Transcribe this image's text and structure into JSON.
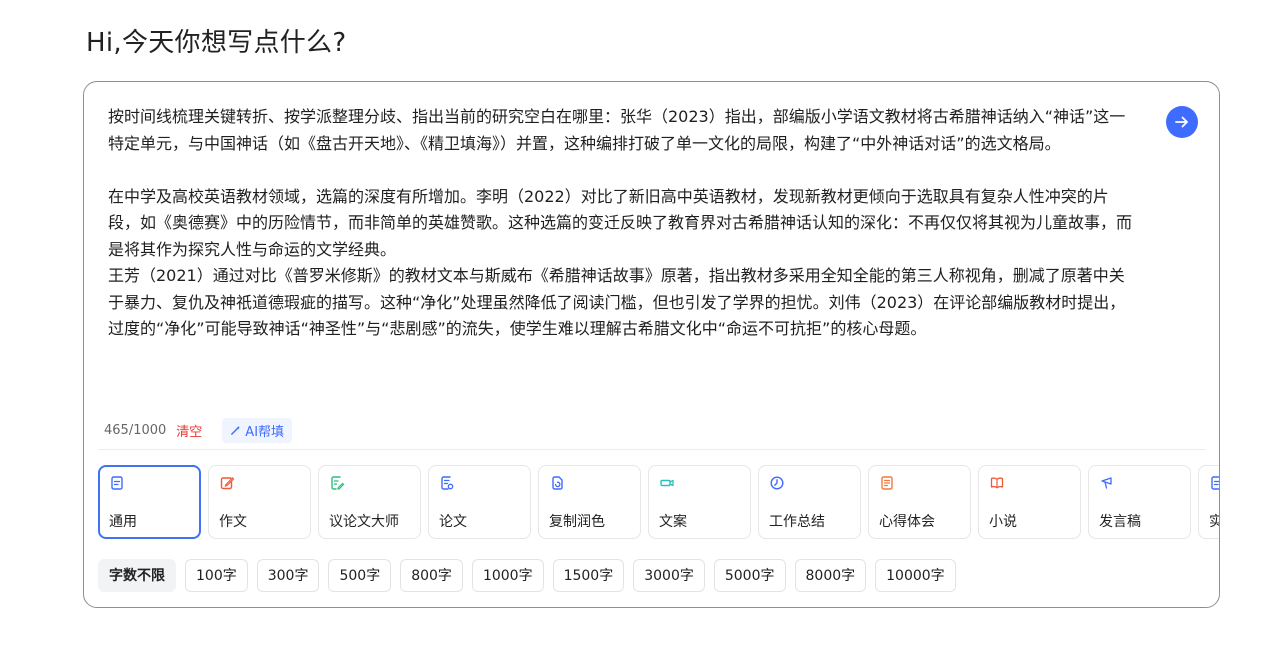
{
  "greeting": "Hi,今天你想写点什么?",
  "editor": {
    "text": "按时间线梳理关键转折、按学派整理分歧、指出当前的研究空白在哪里：张华（2023）指出，部编版小学语文教材将古希腊神话纳入“神话”这一特定单元，与中国神话（如《盘古开天地》、《精卫填海》）并置，这种编排打破了单一文化的局限，构建了“中外神话对话”的选文格局。\n\n在中学及高校英语教材领域，选篇的深度有所增加。李明（2022）对比了新旧高中英语教材，发现新教材更倾向于选取具有复杂人性冲突的片段，如《奥德赛》中的历险情节，而非简单的英雄赞歌。这种选篇的变迁反映了教育界对古希腊神话认知的深化：不再仅仅将其视为儿童故事，而是将其作为探究人性与命运的文学经典。\n王芳（2021）通过对比《普罗米修斯》的教材文本与斯威布《希腊神话故事》原著，指出教材多采用全知全能的第三人称视角，删减了原著中关于暴力、复仇及神祇道德瑕疵的描写。这种“净化”处理虽然降低了阅读门槛，但也引发了学界的担忧。刘伟（2023）在评论部编版教材时提出，过度的“净化”可能导致神话“神圣性”与“悲剧感”的流失，使学生难以理解古希腊文化中“命运不可抗拒”的核心母题。"
  },
  "meta": {
    "count": "465/1000",
    "clear_label": "清空",
    "ai_fill_label": "AI帮填"
  },
  "types": [
    {
      "label": "通用",
      "icon": "doc-icon",
      "color": "#3f6bff"
    },
    {
      "label": "作文",
      "icon": "pencil-square-icon",
      "color": "#f05a3c"
    },
    {
      "label": "议论文大师",
      "icon": "doc-edit-icon",
      "color": "#2bbf7c"
    },
    {
      "label": "论文",
      "icon": "paper-icon",
      "color": "#3f6bff"
    },
    {
      "label": "复制润色",
      "icon": "refresh-doc-icon",
      "color": "#3f6bff"
    },
    {
      "label": "文案",
      "icon": "speaker-icon",
      "color": "#2bbfbf"
    },
    {
      "label": "工作总结",
      "icon": "clock-icon",
      "color": "#3f6bff"
    },
    {
      "label": "心得体会",
      "icon": "note-icon",
      "color": "#f07a3c"
    },
    {
      "label": "小说",
      "icon": "book-icon",
      "color": "#f05a3c"
    },
    {
      "label": "发言稿",
      "icon": "microphone-icon",
      "color": "#3f6bff"
    },
    {
      "label": "实",
      "icon": "doc-icon",
      "color": "#3f6bff"
    }
  ],
  "word_limits": [
    "字数不限",
    "100字",
    "300字",
    "500字",
    "800字",
    "1000字",
    "1500字",
    "3000字",
    "5000字",
    "8000字",
    "10000字"
  ]
}
